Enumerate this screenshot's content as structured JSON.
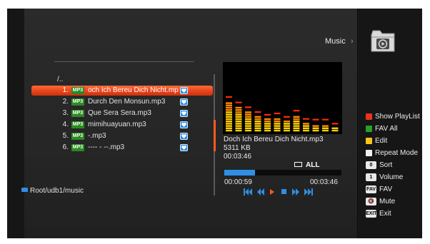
{
  "header": {
    "title": "Music"
  },
  "playlist": {
    "parent": "/..",
    "items": [
      {
        "num": "1.",
        "badge": "MP3",
        "name": "och Ich Bereu  Dich Nicht.mp",
        "selected": true
      },
      {
        "num": "2.",
        "badge": "MP3",
        "name": "Durch Den Monsun.mp3"
      },
      {
        "num": "3.",
        "badge": "MP3",
        "name": "Que Sera Sera.mp3"
      },
      {
        "num": "4.",
        "badge": "MP3",
        "name": "mimihuayuan.mp3"
      },
      {
        "num": "5.",
        "badge": "MP3",
        "name": "-.mp3"
      },
      {
        "num": "6.",
        "badge": "MP3",
        "name": "---- - --.mp3"
      }
    ]
  },
  "path": "Root/udb1/music",
  "now_playing": {
    "title": "Doch Ich Bereu  Dich Nicht.mp3",
    "size": "5311 KB",
    "duration": "00:03:46",
    "repeat": "ALL",
    "elapsed": "00:00:59",
    "total": "00:03:46",
    "progress": 0.26
  },
  "spectrum_levels": [
    0.46,
    0.38,
    0.31,
    0.24,
    0.2,
    0.22,
    0.17,
    0.26,
    0.14,
    0.13,
    0.13,
    0.07
  ],
  "controls": [
    "prev-track-icon",
    "rewind-icon",
    "play-icon",
    "stop-icon",
    "fast-forward-icon",
    "next-track-icon"
  ],
  "legend": [
    {
      "swatch": "#e8331e",
      "label": "Show PlayList"
    },
    {
      "swatch": "#26a12a",
      "label": "FAV All"
    },
    {
      "swatch": "#f5c51a",
      "label": "Edit"
    },
    {
      "swatch": "#f0f0f0",
      "label": "Repeat Mode"
    },
    {
      "key": "0",
      "label": "Sort"
    },
    {
      "key": "1",
      "label": "Volume"
    },
    {
      "key": "FAV",
      "label": "FAV"
    },
    {
      "key": "🔇",
      "label": "Mute"
    },
    {
      "key": "EXIT",
      "label": "Exit"
    }
  ],
  "colors": {
    "accent": "#ff5a1f",
    "highlight_blue": "#2f8fe6",
    "badge_green": "#2a8a21"
  }
}
